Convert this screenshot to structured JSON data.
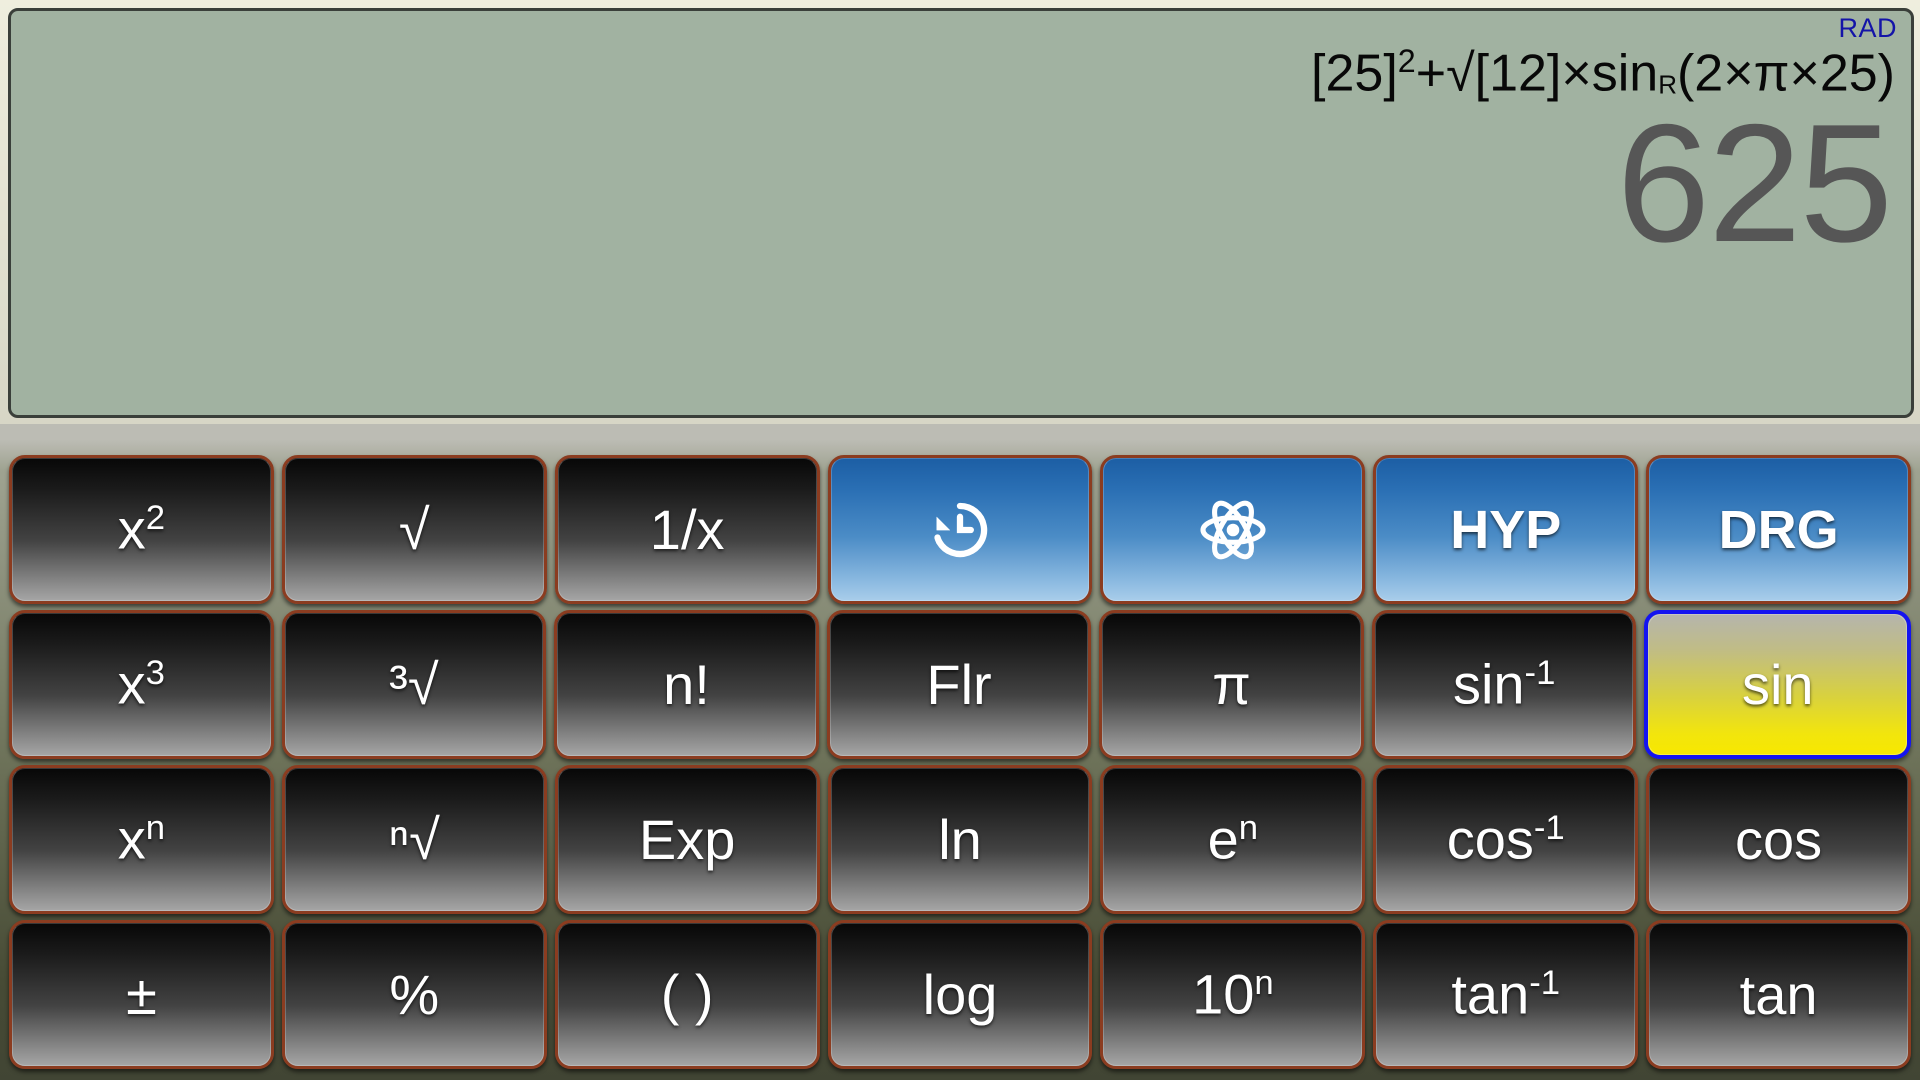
{
  "display": {
    "mode_indicator": "RAD",
    "expression": "[25]²+√[12]×sin_R(2×π×25)",
    "expression_parts": {
      "open": "[25]",
      "sq": "2",
      "plus_root": "+√[12]×sin",
      "sub_r": "R",
      "args": "(2×π×25)"
    },
    "result": "625",
    "panel_color": "#a1b2a1",
    "mode_color": "#1414a8",
    "result_color": "#565656"
  },
  "keypad": {
    "border_color": "#8b3c20",
    "accent_blue": "#1c5ea4",
    "active_yellow": "#f7e800",
    "active_focus_ring": "#1414f0",
    "rows": [
      [
        {
          "name": "x-squared",
          "label": "x",
          "sup": "2",
          "style": "dark"
        },
        {
          "name": "square-root",
          "label": "√",
          "sup": "",
          "style": "dark"
        },
        {
          "name": "reciprocal",
          "label": "1/x",
          "sup": "",
          "style": "dark"
        },
        {
          "name": "history",
          "label": "",
          "sup": "",
          "style": "blue",
          "icon": "history-icon"
        },
        {
          "name": "constants",
          "label": "",
          "sup": "",
          "style": "blue",
          "icon": "atom-icon"
        },
        {
          "name": "hyperbolic",
          "label": "HYP",
          "sup": "",
          "style": "blue"
        },
        {
          "name": "angle-mode",
          "label": "DRG",
          "sup": "",
          "style": "blue"
        }
      ],
      [
        {
          "name": "x-cubed",
          "label": "x",
          "sup": "3",
          "style": "dark"
        },
        {
          "name": "cube-root",
          "label": "³√",
          "sup": "",
          "style": "dark"
        },
        {
          "name": "factorial",
          "label": "n!",
          "sup": "",
          "style": "dark"
        },
        {
          "name": "floor",
          "label": "Flr",
          "sup": "",
          "style": "dark"
        },
        {
          "name": "pi",
          "label": "π",
          "sup": "",
          "style": "dark"
        },
        {
          "name": "arcsine",
          "label": "sin",
          "sup": "-1",
          "style": "dark"
        },
        {
          "name": "sine",
          "label": "sin",
          "sup": "",
          "style": "active"
        }
      ],
      [
        {
          "name": "x-power-n",
          "label": "x",
          "sup": "n",
          "style": "dark"
        },
        {
          "name": "nth-root",
          "label": "ⁿ√",
          "sup": "",
          "style": "dark"
        },
        {
          "name": "exponent",
          "label": "Exp",
          "sup": "",
          "style": "dark"
        },
        {
          "name": "natural-log",
          "label": "ln",
          "sup": "",
          "style": "dark"
        },
        {
          "name": "e-power-n",
          "label": "e",
          "sup": "n",
          "style": "dark"
        },
        {
          "name": "arccosine",
          "label": "cos",
          "sup": "-1",
          "style": "dark"
        },
        {
          "name": "cosine",
          "label": "cos",
          "sup": "",
          "style": "dark"
        }
      ],
      [
        {
          "name": "plus-minus",
          "label": "±",
          "sup": "",
          "style": "dark"
        },
        {
          "name": "percent",
          "label": "%",
          "sup": "",
          "style": "dark"
        },
        {
          "name": "parentheses",
          "label": "( )",
          "sup": "",
          "style": "dark"
        },
        {
          "name": "log-base-10",
          "label": "log",
          "sup": "",
          "style": "dark"
        },
        {
          "name": "ten-power-n",
          "label": "10",
          "sup": "n",
          "style": "dark"
        },
        {
          "name": "arctangent",
          "label": "tan",
          "sup": "-1",
          "style": "dark"
        },
        {
          "name": "tangent",
          "label": "tan",
          "sup": "",
          "style": "dark"
        }
      ]
    ]
  }
}
